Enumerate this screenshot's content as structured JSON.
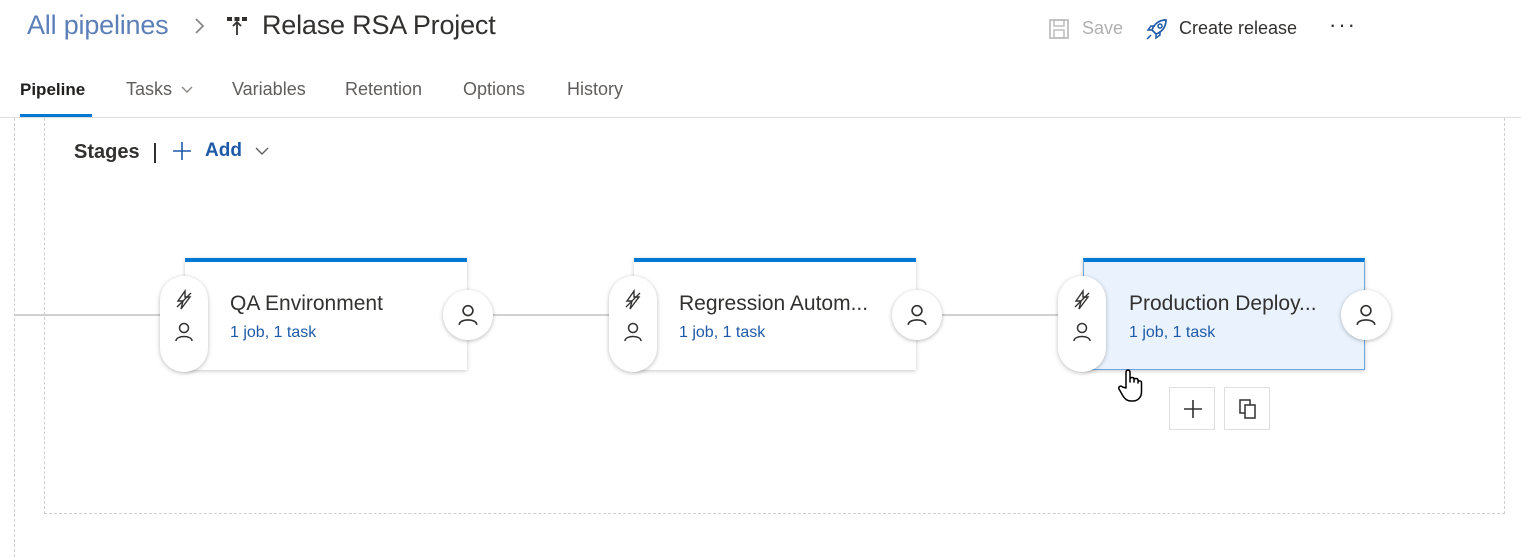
{
  "header": {
    "breadcrumb_root": "All pipelines",
    "pipeline_name": "Relase RSA Project",
    "save_label": "Save",
    "create_release_label": "Create release",
    "more_label": "···"
  },
  "tabs": [
    {
      "label": "Pipeline",
      "active": true
    },
    {
      "label": "Tasks",
      "has_dropdown": true
    },
    {
      "label": "Variables"
    },
    {
      "label": "Retention"
    },
    {
      "label": "Options"
    },
    {
      "label": "History"
    }
  ],
  "stages_toolbar": {
    "title": "Stages",
    "add_label": "Add"
  },
  "stages": [
    {
      "name": "QA Environment",
      "summary": "1 job, 1 task",
      "selected": false
    },
    {
      "name": "Regression Autom...",
      "summary": "1 job, 1 task",
      "selected": false
    },
    {
      "name": "Production Deploy...",
      "summary": "1 job, 1 task",
      "selected": true
    }
  ],
  "icons": {
    "breadcrumb_separator": "chevron-right-icon",
    "pipeline": "release-pipeline-icon",
    "save": "save-icon",
    "create_release": "rocket-icon",
    "pre_deploy_trigger": "lightning-icon",
    "pre_deploy_approval": "person-icon",
    "post_deploy_approval": "person-icon",
    "add_stage": "plus-icon",
    "clone_stage": "clone-icon"
  },
  "colors": {
    "accent": "#0078d4",
    "link": "#1e5aa8",
    "breadcrumb": "#5c7fb8",
    "selected_stage_bg": "#eaf3fd"
  }
}
